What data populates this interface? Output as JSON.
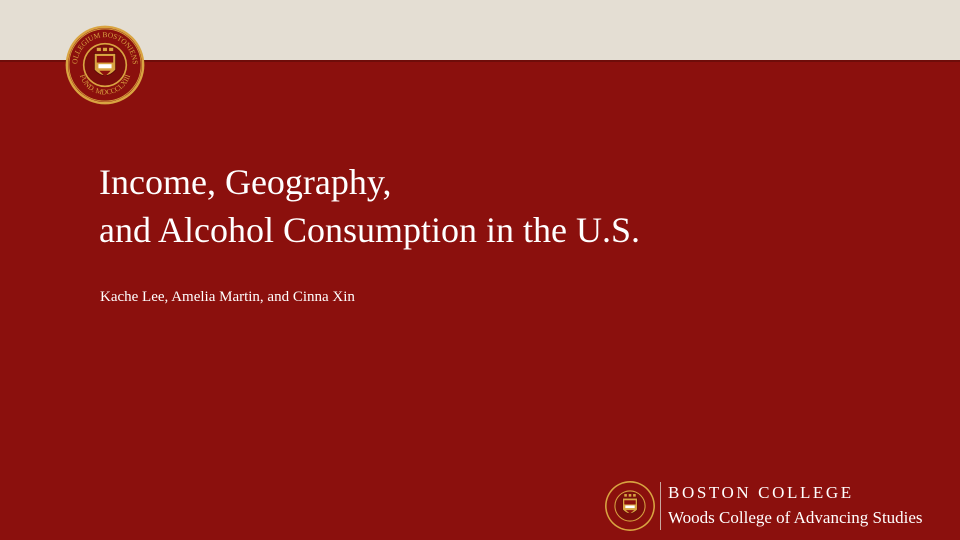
{
  "slide": {
    "title_lines": [
      "Income, Geography,",
      "and Alcohol Consumption in the U.S."
    ],
    "authors": "Kache Lee, Amelia Martin, and Cinna Xin"
  },
  "seal": {
    "ring_text": "COLLEGIUM BOSTONIENSE · FUND. MDCCCLXIII",
    "icon": "boston-college-seal-icon"
  },
  "footer": {
    "institution": "BOSTON COLLEGE",
    "school": "Woods College of Advancing Studies",
    "icon": "boston-college-seal-icon"
  },
  "colors": {
    "background": "#8b100d",
    "top_band": "#e4ded3",
    "text": "#ffffff",
    "seal_gold": "#d9a441"
  }
}
